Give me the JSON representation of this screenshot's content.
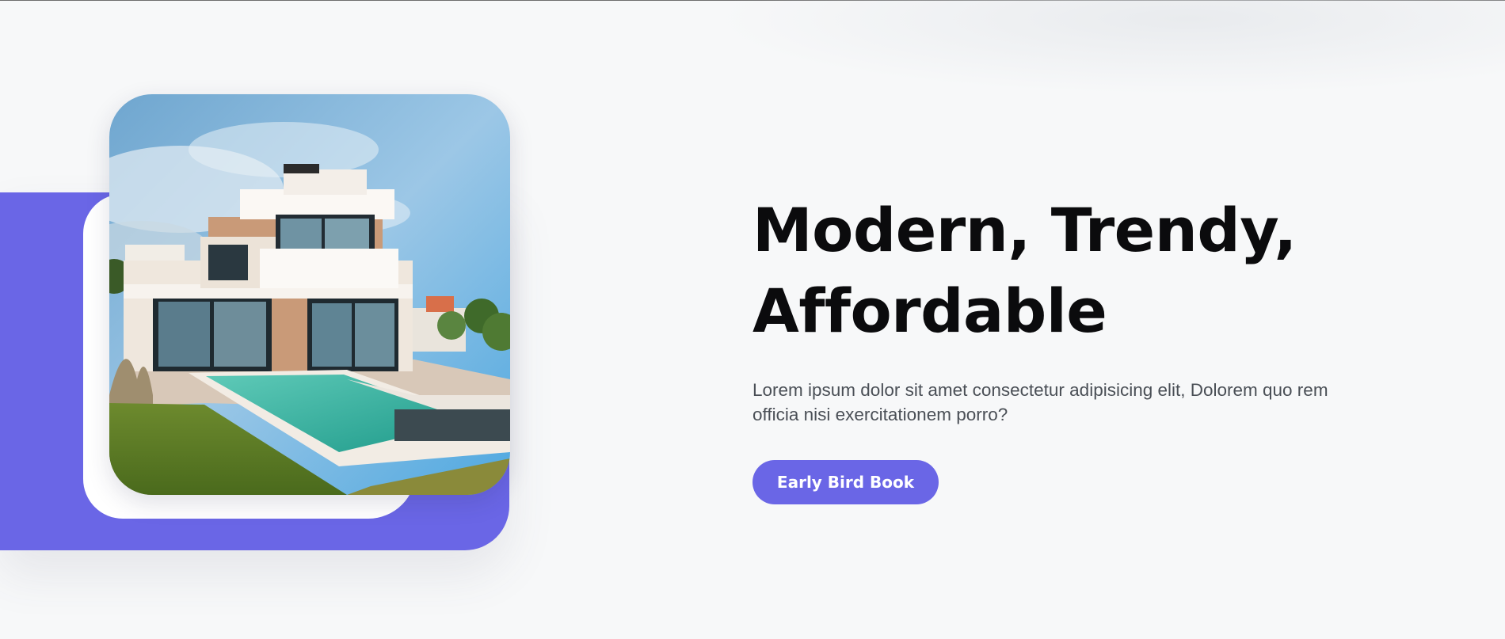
{
  "hero": {
    "headline_line1": "Modern, Trendy,",
    "headline_line2": "Affordable",
    "description": "Lorem ipsum dolor sit amet consectetur adipisicing elit, Dolorem quo rem officia nisi exercitationem porro?",
    "cta_label": "Early Bird Book"
  },
  "colors": {
    "accent": "#6a66e6",
    "background": "#f7f8f9",
    "headline": "#0b0b0d",
    "body_text": "#4a4f56"
  },
  "image": {
    "subject": "modern-villa-with-pool-photo"
  }
}
